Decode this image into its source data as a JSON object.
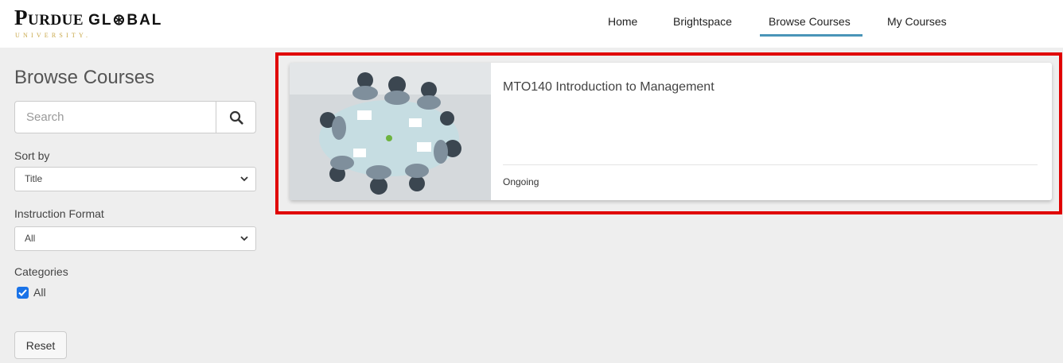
{
  "header": {
    "logo": {
      "main_big": "P",
      "main_small": "URDUE",
      "global": "GL⊛BAL",
      "sub": "UNIVERSITY."
    },
    "nav": [
      {
        "label": "Home"
      },
      {
        "label": "Brightspace"
      },
      {
        "label": "Browse Courses",
        "active": true
      },
      {
        "label": "My Courses"
      }
    ]
  },
  "sidebar": {
    "title": "Browse Courses",
    "search": {
      "placeholder": "Search",
      "value": ""
    },
    "sort": {
      "label": "Sort by",
      "selected": "Title"
    },
    "format": {
      "label": "Instruction Format",
      "selected": "All"
    },
    "categories": {
      "label": "Categories",
      "options": [
        {
          "label": "All",
          "checked": true
        }
      ]
    },
    "reset_label": "Reset"
  },
  "courses": [
    {
      "title": "MTO140 Introduction to Management",
      "status": "Ongoing",
      "image": "meeting-table-photo"
    }
  ],
  "colors": {
    "accent": "#4a95b8",
    "highlight": "#e00000",
    "checkbox": "#1a73e8",
    "background": "#eeeeee"
  }
}
